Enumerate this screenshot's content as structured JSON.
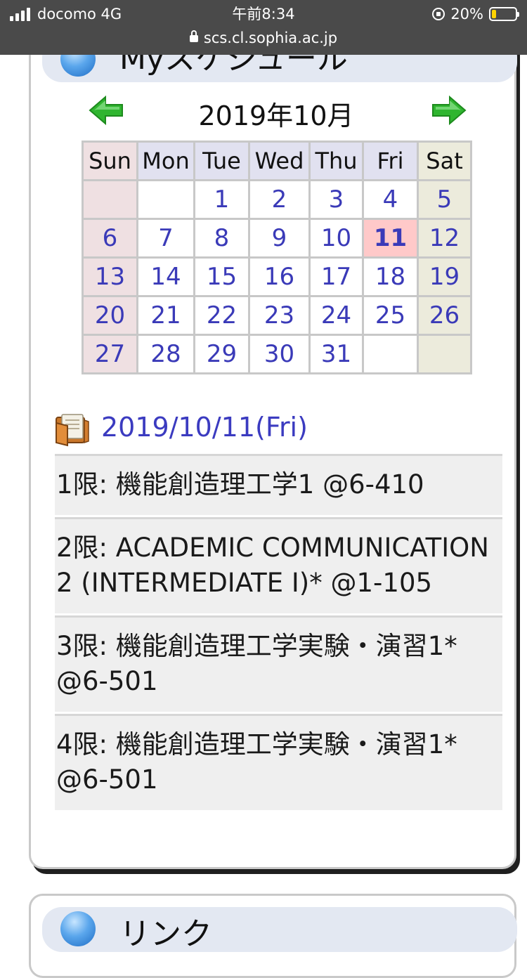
{
  "status_bar": {
    "carrier": "docomo 4G",
    "time": "午前8:34",
    "battery": "20%",
    "url": "scs.cl.sophia.ac.jp"
  },
  "schedule_section": {
    "title": "Myスケジュール",
    "calendar": {
      "title": "2019年10月",
      "weekdays": [
        "Sun",
        "Mon",
        "Tue",
        "Wed",
        "Thu",
        "Fri",
        "Sat"
      ],
      "weeks": [
        [
          "",
          "",
          "1",
          "2",
          "3",
          "4",
          "5"
        ],
        [
          "6",
          "7",
          "8",
          "9",
          "10",
          "11",
          "12"
        ],
        [
          "13",
          "14",
          "15",
          "16",
          "17",
          "18",
          "19"
        ],
        [
          "20",
          "21",
          "22",
          "23",
          "24",
          "25",
          "26"
        ],
        [
          "27",
          "28",
          "29",
          "30",
          "31",
          "",
          ""
        ]
      ],
      "today": "11"
    },
    "selected_date": "2019/10/11(Fri)",
    "classes": [
      "1限: 機能創造理工学1 @6-410",
      "2限: ACADEMIC COMMUNICATION 2 (INTERMEDIATE I)* @1-105",
      "3限: 機能創造理工学実験・演習1* @6-501",
      "4限: 機能創造理工学実験・演習1* @6-501"
    ]
  },
  "links_section": {
    "title": "リンク"
  },
  "icons": {
    "section": "info-icon",
    "prev": "arrow-left-icon",
    "next": "arrow-right-icon",
    "date": "folder-icon"
  },
  "colors": {
    "link_blue": "#3b3bc0",
    "today_bg": "#ffc9c9",
    "arrow_green": "#2fb52f"
  }
}
